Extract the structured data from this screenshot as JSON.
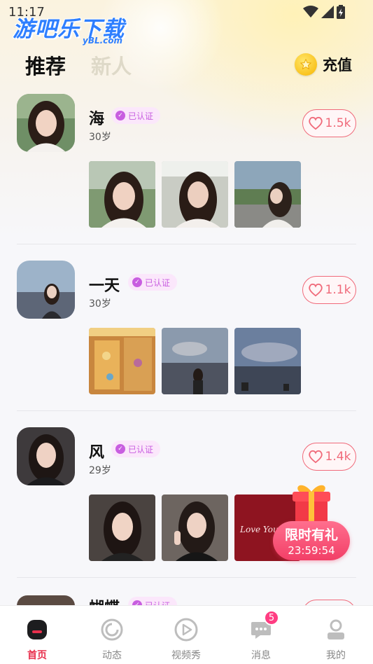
{
  "status_bar": {
    "time": "11:17"
  },
  "watermark": {
    "title": "游吧乐下载",
    "subtitle": "yBL.com"
  },
  "header": {
    "tabs": [
      {
        "label": "推荐",
        "active": true
      },
      {
        "label": "新人",
        "active": false
      }
    ],
    "recharge_label": "充值"
  },
  "colors": {
    "accent": "#e8304d",
    "like": "#f06a7a",
    "badge": "#c85ee0",
    "badge_bg": "#fbe7fb",
    "gift": "#f23f67"
  },
  "verified_label": "已认证",
  "users": [
    {
      "name": "海",
      "age": "30岁",
      "likes": "1.5k"
    },
    {
      "name": "一天",
      "age": "30岁",
      "likes": "1.1k"
    },
    {
      "name": "风",
      "age": "29岁",
      "likes": "1.4k"
    },
    {
      "name": "蝴蝶",
      "age": "",
      "likes": ""
    }
  ],
  "gift_promo": {
    "title": "限时有礼",
    "timer": "23:59:54",
    "photo_text": "Love You"
  },
  "bottom_nav": [
    {
      "label": "首页",
      "icon": "home-icon",
      "active": true
    },
    {
      "label": "动态",
      "icon": "moments-icon",
      "active": false
    },
    {
      "label": "视频秀",
      "icon": "video-icon",
      "active": false
    },
    {
      "label": "消息",
      "icon": "message-icon",
      "active": false,
      "badge": "5"
    },
    {
      "label": "我的",
      "icon": "profile-icon",
      "active": false
    }
  ]
}
